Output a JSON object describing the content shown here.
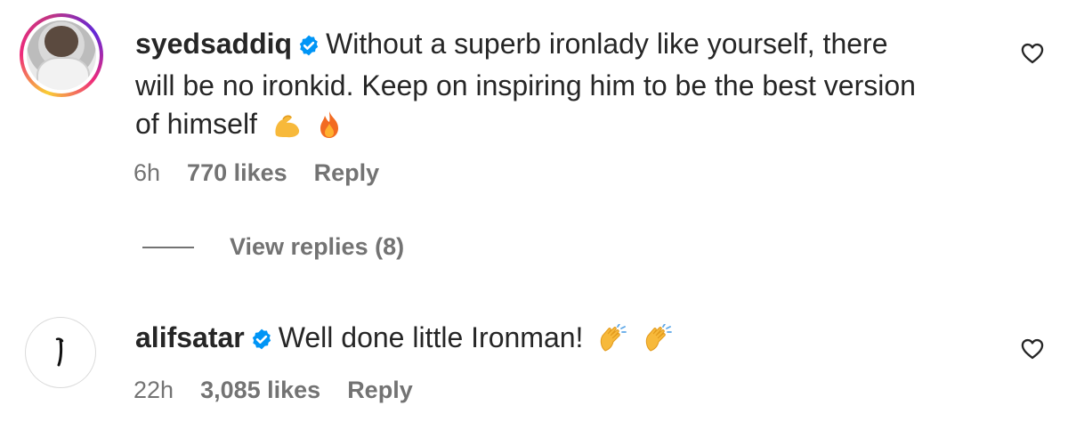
{
  "comments": [
    {
      "username": "syedsaddiq",
      "text_line1": "Without a superb ironlady like yourself, there",
      "text_line2": "will be no ironkid. Keep on inspiring him to be the best version",
      "text_line3": "of himself",
      "emojis": [
        "flexed-biceps-emoji",
        "fire-emoji"
      ],
      "time": "6h",
      "likes": "770 likes",
      "reply_label": "Reply",
      "view_replies_label": "View replies (8)"
    },
    {
      "username": "alifsatar",
      "text_line1": "Well done little Ironman!",
      "emojis": [
        "clapping-hands-emoji",
        "clapping-hands-emoji"
      ],
      "time": "22h",
      "likes": "3,085 likes",
      "reply_label": "Reply"
    }
  ],
  "colors": {
    "text": "#262626",
    "secondary": "#737373",
    "verified": "#0095f6",
    "story_ring": [
      "#f9ce34",
      "#ee2a7b",
      "#6228d7"
    ]
  },
  "icons": {
    "verified": "verified-badge-icon",
    "like": "heart-outline-icon"
  }
}
